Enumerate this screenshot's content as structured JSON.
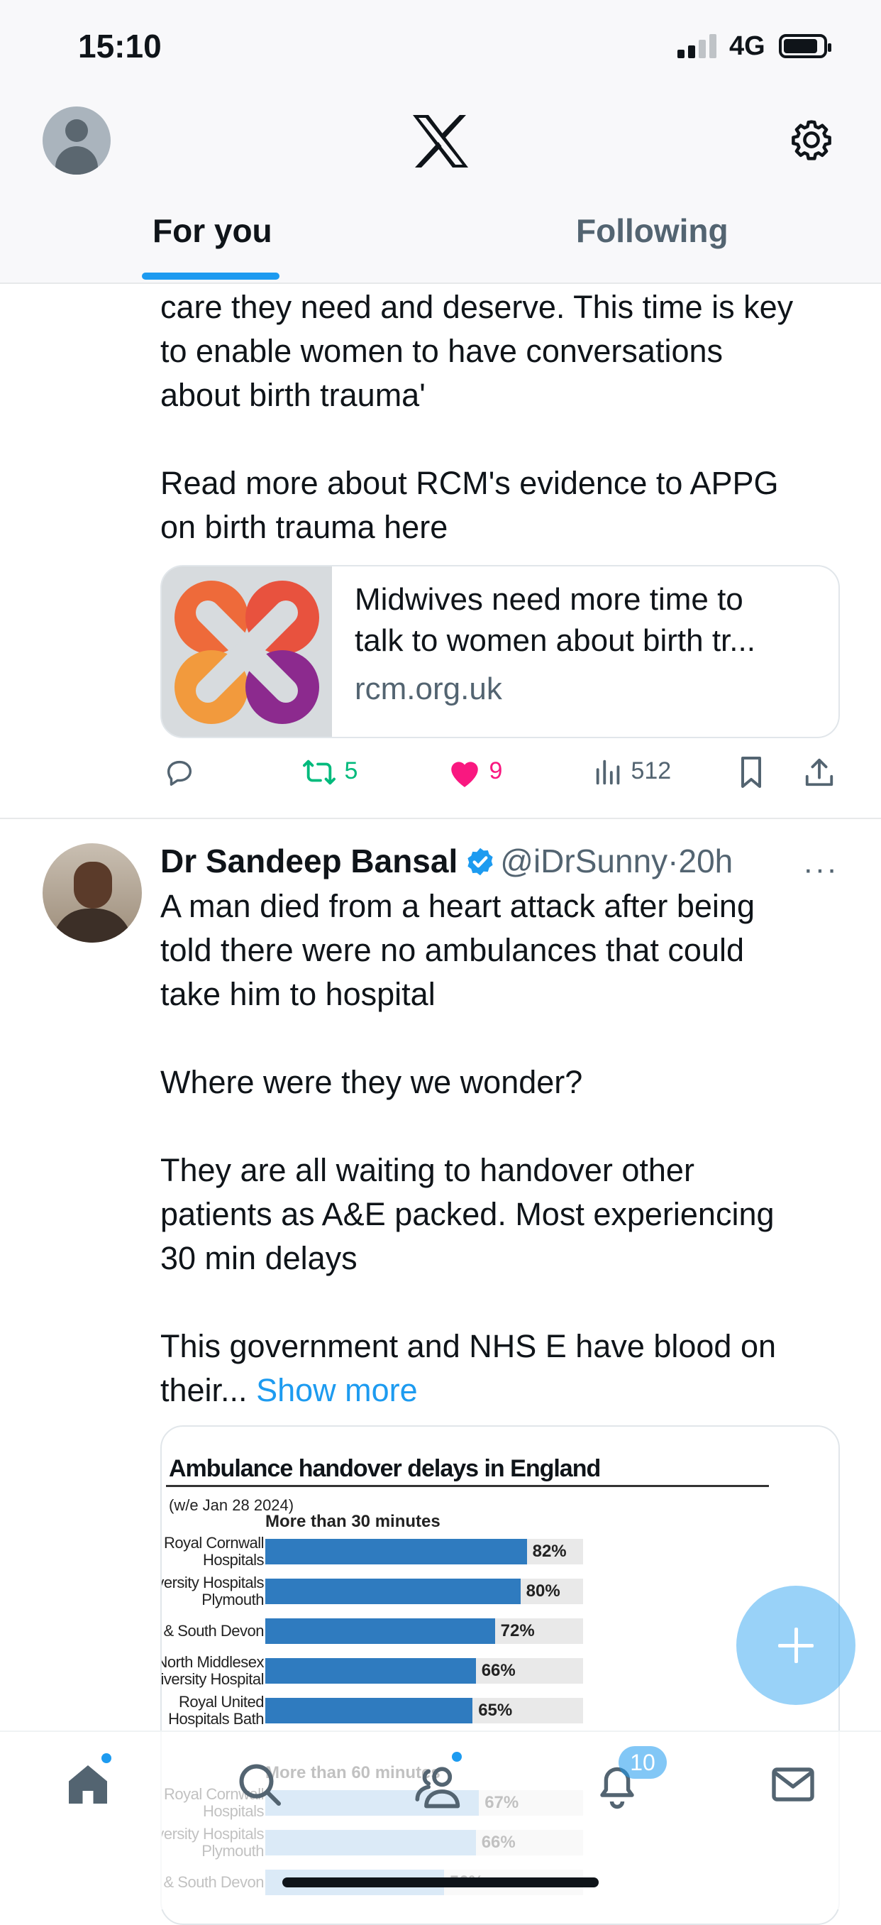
{
  "status_bar": {
    "time": "15:10",
    "network": "4G"
  },
  "header": {
    "tabs": [
      {
        "label": "For you",
        "active": true
      },
      {
        "label": "Following",
        "active": false
      }
    ],
    "icons": {
      "profile": "avatar",
      "logo": "x-logo-icon",
      "settings": "gear-icon"
    }
  },
  "post1": {
    "text": "care they need and deserve. This time is key\nto enable women to have conversations\nabout birth trauma'\n\nRead more about RCM's evidence to APPG\non birth trauma here",
    "link_card": {
      "title": "Midwives need more time to\ntalk to women about birth tr...",
      "domain": "rcm.org.uk"
    },
    "actions": {
      "replies": "",
      "reposts": "5",
      "likes": "9",
      "views": "512"
    }
  },
  "post2": {
    "author_name": "Dr Sandeep Bansal",
    "handle": "@iDrSunny",
    "separator": "·",
    "time": "20h",
    "more": "···",
    "text": "A man died from a heart attack after being\ntold there were no ambulances that could\ntake him to hospital\n\nWhere were they we wonder?\n\nThey are all waiting to handover other\npatients as A&E packed. Most experiencing\n30 min delays\n\nThis government and NHS E have blood on\ntheir... ",
    "show_more": "Show more"
  },
  "chart_data": {
    "type": "bar",
    "title": "Ambulance handover delays in England",
    "subtitle": "(w/e Jan 28 2024)",
    "xlim": [
      0,
      100
    ],
    "sections": [
      {
        "name": "More than 30 minutes",
        "color": "#2f7bbf",
        "categories": [
          "Royal Cornwall\nHospitals",
          "University Hospitals\nPlymouth",
          "Torbay & South Devon",
          "North Middlesex\nUniversity Hospital",
          "Royal United\nHospitals Bath"
        ],
        "values": [
          82,
          80,
          72,
          66,
          65
        ],
        "labels": [
          "82%",
          "80%",
          "72%",
          "66%",
          "65%"
        ]
      },
      {
        "name": "More than 60 minutes",
        "color": "#7fb4e0",
        "categories": [
          "Royal Cornwall\nHospitals",
          "University Hospitals\nPlymouth",
          "Torbay & South Devon"
        ],
        "values": [
          67,
          66,
          56
        ],
        "labels": [
          "67%",
          "66%",
          "56%"
        ]
      }
    ]
  },
  "bottom_nav": {
    "items": [
      "home-icon",
      "search-icon",
      "communities-icon",
      "notifications-icon",
      "messages-icon"
    ],
    "notifications_badge": "10"
  }
}
